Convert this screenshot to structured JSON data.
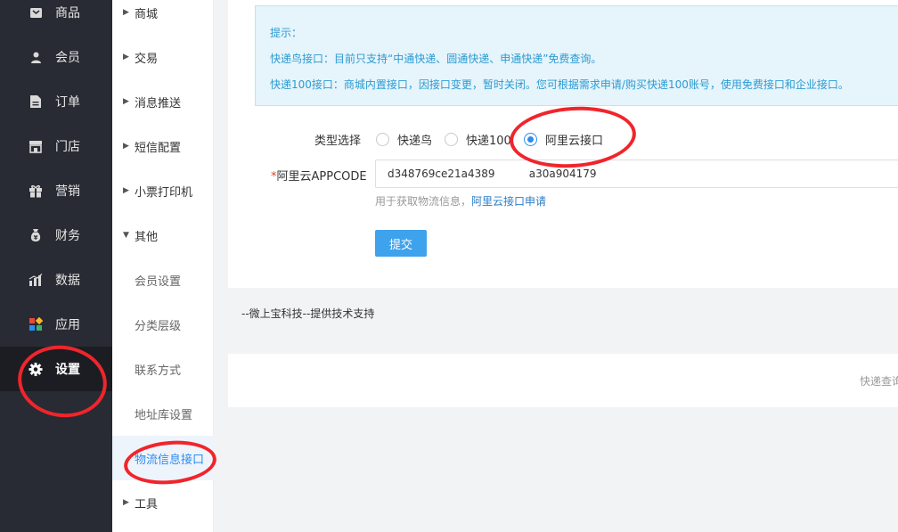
{
  "sidebar": {
    "items": [
      {
        "label": "商品",
        "icon": "goods-icon"
      },
      {
        "label": "会员",
        "icon": "user-icon"
      },
      {
        "label": "订单",
        "icon": "order-icon"
      },
      {
        "label": "门店",
        "icon": "store-icon"
      },
      {
        "label": "营销",
        "icon": "gift-icon"
      },
      {
        "label": "财务",
        "icon": "money-bag-icon"
      },
      {
        "label": "数据",
        "icon": "chart-icon"
      },
      {
        "label": "应用",
        "icon": "apps-icon"
      },
      {
        "label": "设置",
        "icon": "gear-icon"
      }
    ],
    "active": "设置"
  },
  "subnav": {
    "items": [
      {
        "label": "商城"
      },
      {
        "label": "交易"
      },
      {
        "label": "消息推送"
      },
      {
        "label": "短信配置"
      },
      {
        "label": "小票打印机"
      },
      {
        "label": "其他"
      },
      {
        "label": "会员设置"
      },
      {
        "label": "分类层级"
      },
      {
        "label": "联系方式"
      },
      {
        "label": "地址库设置"
      },
      {
        "label": "物流信息接口"
      },
      {
        "label": "工具"
      }
    ],
    "current": "物流信息接口"
  },
  "tip": {
    "title": "提示：",
    "line1": "快递鸟接口：目前只支持“中通快递、圆通快递、申通快递”免费查询。",
    "line2": "快递100接口：商城内置接口，因接口变更，暂时关闭。您可根据需求申请/购买快递100账号，使用免费接口和企业接口。"
  },
  "form": {
    "type_label": "类型选择",
    "options": [
      {
        "label": "快递鸟",
        "checked": false
      },
      {
        "label": "快递100",
        "checked": false
      },
      {
        "label": "阿里云接口",
        "checked": true
      }
    ],
    "appcode_required": "*",
    "appcode_label": "阿里云APPCODE",
    "appcode_value": "d348769ce21a4389          a30a904179",
    "help_text": "用于获取物流信息，",
    "help_link": "阿里云接口申请",
    "submit_label": "提交"
  },
  "footer": {
    "text": "--微上宝科技--提供技术支持",
    "bottom_text": "快递查询"
  },
  "colors": {
    "accent": "#2d8cf0",
    "sidebar_bg": "#282b33",
    "annotation": "#f0252b"
  }
}
